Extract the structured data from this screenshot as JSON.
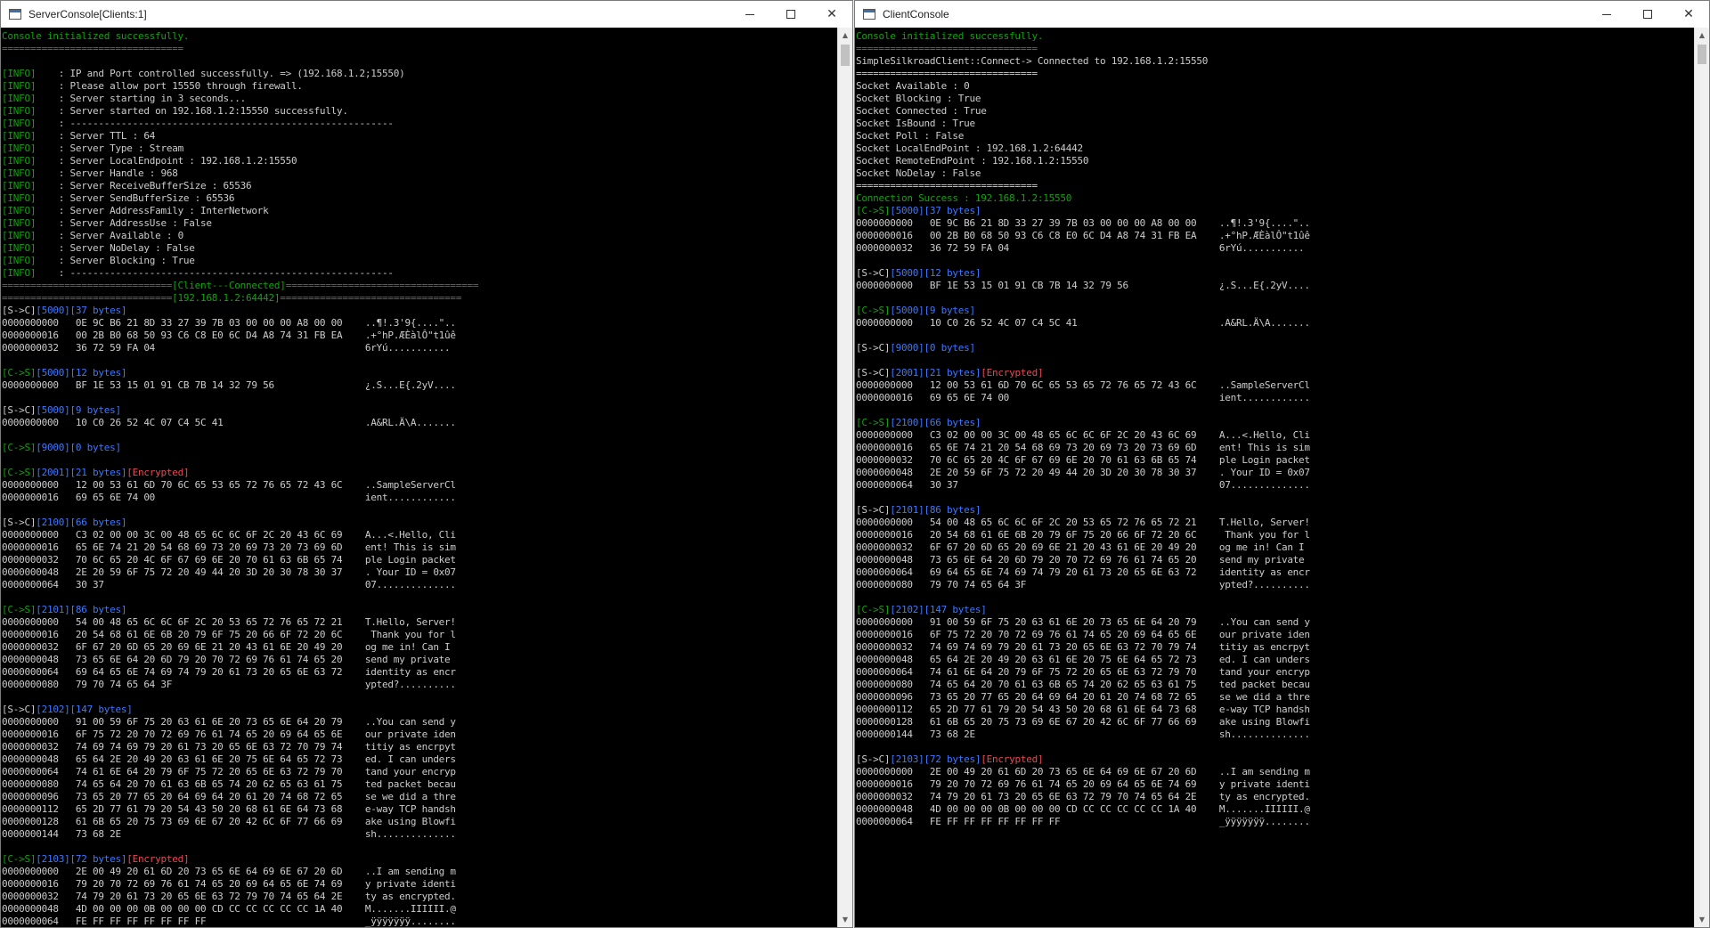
{
  "server": {
    "title": "ServerConsole[Clients:1]",
    "lines": [
      [
        [
          "g",
          "Console initialized successfully."
        ]
      ],
      [
        [
          "g",
          "================================"
        ]
      ],
      [],
      [
        [
          "g",
          "[INFO]"
        ],
        [
          "w",
          "    : IP and Port controlled successfully. => (192.168.1.2;15550)"
        ]
      ],
      [
        [
          "g",
          "[INFO]"
        ],
        [
          "w",
          "    : Please allow port 15550 through firewall."
        ]
      ],
      [
        [
          "g",
          "[INFO]"
        ],
        [
          "w",
          "    : Server starting in 3 seconds..."
        ]
      ],
      [
        [
          "g",
          "[INFO]"
        ],
        [
          "w",
          "    : Server started on 192.168.1.2:15550 successfully."
        ]
      ],
      [
        [
          "g",
          "[INFO]"
        ],
        [
          "w",
          "    : ---------------------------------------------------------"
        ]
      ],
      [
        [
          "g",
          "[INFO]"
        ],
        [
          "w",
          "    : Server TTL : 64"
        ]
      ],
      [
        [
          "g",
          "[INFO]"
        ],
        [
          "w",
          "    : Server Type : Stream"
        ]
      ],
      [
        [
          "g",
          "[INFO]"
        ],
        [
          "w",
          "    : Server LocalEndpoint : 192.168.1.2:15550"
        ]
      ],
      [
        [
          "g",
          "[INFO]"
        ],
        [
          "w",
          "    : Server Handle : 968"
        ]
      ],
      [
        [
          "g",
          "[INFO]"
        ],
        [
          "w",
          "    : Server ReceiveBufferSize : 65536"
        ]
      ],
      [
        [
          "g",
          "[INFO]"
        ],
        [
          "w",
          "    : Server SendBufferSize : 65536"
        ]
      ],
      [
        [
          "g",
          "[INFO]"
        ],
        [
          "w",
          "    : Server AddressFamily : InterNetwork"
        ]
      ],
      [
        [
          "g",
          "[INFO]"
        ],
        [
          "w",
          "    : Server AddressUse : False"
        ]
      ],
      [
        [
          "g",
          "[INFO]"
        ],
        [
          "w",
          "    : Server Available : 0"
        ]
      ],
      [
        [
          "g",
          "[INFO]"
        ],
        [
          "w",
          "    : Server NoDelay : False"
        ]
      ],
      [
        [
          "g",
          "[INFO]"
        ],
        [
          "w",
          "    : Server Blocking : True"
        ]
      ],
      [
        [
          "g",
          "[INFO]"
        ],
        [
          "w",
          "    : ---------------------------------------------------------"
        ]
      ],
      [
        [
          "g",
          "==============================[Client---Connected]=================================="
        ]
      ],
      [
        [
          "g",
          "==============================[192.168.1.2:64442]================================"
        ]
      ],
      [
        [
          "w",
          "[S->C]"
        ],
        [
          "b",
          "[5000][37 bytes]"
        ]
      ],
      [
        [
          "w",
          "0000000000   0E 9C B6 21 8D 33 27 39 7B 03 00 00 00 A8 00 00    ..¶!.3'9{....\"..  "
        ]
      ],
      [
        [
          "w",
          "0000000016   00 2B B0 68 50 93 C6 C8 E0 6C D4 A8 74 31 FB EA    .+°hP.ÆÈàlÔ\"t1ûê"
        ]
      ],
      [
        [
          "w",
          "0000000032   36 72 59 FA 04                                     6rYú..........."
        ]
      ],
      [],
      [
        [
          "g",
          "[C->S]"
        ],
        [
          "b",
          "[5000][12 bytes]"
        ]
      ],
      [
        [
          "w",
          "0000000000   BF 1E 53 15 01 91 CB 7B 14 32 79 56                ¿.S...E{.2yV...."
        ]
      ],
      [],
      [
        [
          "w",
          "[S->C]"
        ],
        [
          "b",
          "[5000][9 bytes]"
        ]
      ],
      [
        [
          "w",
          "0000000000   10 C0 26 52 4C 07 C4 5C 41                         .A&RL.Ä\\A......."
        ]
      ],
      [],
      [
        [
          "g",
          "[C->S]"
        ],
        [
          "b",
          "[9000][0 bytes]"
        ]
      ],
      [],
      [
        [
          "g",
          "[C->S]"
        ],
        [
          "b",
          "[2001][21 bytes]"
        ],
        [
          "r",
          "[Encrypted]"
        ]
      ],
      [
        [
          "w",
          "0000000000   12 00 53 61 6D 70 6C 65 53 65 72 76 65 72 43 6C    ..SampleServerCl"
        ]
      ],
      [
        [
          "w",
          "0000000016   69 65 6E 74 00                                     ient............"
        ]
      ],
      [],
      [
        [
          "w",
          "[S->C]"
        ],
        [
          "b",
          "[2100][66 bytes]"
        ]
      ],
      [
        [
          "w",
          "0000000000   C3 02 00 00 3C 00 48 65 6C 6C 6F 2C 20 43 6C 69    A...<.Hello, Cli"
        ]
      ],
      [
        [
          "w",
          "0000000016   65 6E 74 21 20 54 68 69 73 20 69 73 20 73 69 6D    ent! This is sim"
        ]
      ],
      [
        [
          "w",
          "0000000032   70 6C 65 20 4C 6F 67 69 6E 20 70 61 63 6B 65 74    ple Login packet"
        ]
      ],
      [
        [
          "w",
          "0000000048   2E 20 59 6F 75 72 20 49 44 20 3D 20 30 78 30 37    . Your ID = 0x07"
        ]
      ],
      [
        [
          "w",
          "0000000064   30 37                                              07.............."
        ]
      ],
      [],
      [
        [
          "g",
          "[C->S]"
        ],
        [
          "b",
          "[2101][86 bytes]"
        ]
      ],
      [
        [
          "w",
          "0000000000   54 00 48 65 6C 6C 6F 2C 20 53 65 72 76 65 72 21    T.Hello, Server!"
        ]
      ],
      [
        [
          "w",
          "0000000016   20 54 68 61 6E 6B 20 79 6F 75 20 66 6F 72 20 6C     Thank you for l"
        ]
      ],
      [
        [
          "w",
          "0000000032   6F 67 20 6D 65 20 69 6E 21 20 43 61 6E 20 49 20    og me in! Can I "
        ]
      ],
      [
        [
          "w",
          "0000000048   73 65 6E 64 20 6D 79 20 70 72 69 76 61 74 65 20    send my private "
        ]
      ],
      [
        [
          "w",
          "0000000064   69 64 65 6E 74 69 74 79 20 61 73 20 65 6E 63 72    identity as encr"
        ]
      ],
      [
        [
          "w",
          "0000000080   79 70 74 65 64 3F                                  ypted?.........."
        ]
      ],
      [],
      [
        [
          "w",
          "[S->C]"
        ],
        [
          "b",
          "[2102][147 bytes]"
        ]
      ],
      [
        [
          "w",
          "0000000000   91 00 59 6F 75 20 63 61 6E 20 73 65 6E 64 20 79    ..You can send y"
        ]
      ],
      [
        [
          "w",
          "0000000016   6F 75 72 20 70 72 69 76 61 74 65 20 69 64 65 6E    our private iden"
        ]
      ],
      [
        [
          "w",
          "0000000032   74 69 74 69 79 20 61 73 20 65 6E 63 72 70 79 74    titiy as encrpyt"
        ]
      ],
      [
        [
          "w",
          "0000000048   65 64 2E 20 49 20 63 61 6E 20 75 6E 64 65 72 73    ed. I can unders"
        ]
      ],
      [
        [
          "w",
          "0000000064   74 61 6E 64 20 79 6F 75 72 20 65 6E 63 72 79 70    tand your encryp"
        ]
      ],
      [
        [
          "w",
          "0000000080   74 65 64 20 70 61 63 6B 65 74 20 62 65 63 61 75    ted packet becau"
        ]
      ],
      [
        [
          "w",
          "0000000096   73 65 20 77 65 20 64 69 64 20 61 20 74 68 72 65    se we did a thre"
        ]
      ],
      [
        [
          "w",
          "0000000112   65 2D 77 61 79 20 54 43 50 20 68 61 6E 64 73 68    e-way TCP handsh"
        ]
      ],
      [
        [
          "w",
          "0000000128   61 6B 65 20 75 73 69 6E 67 20 42 6C 6F 77 66 69    ake using Blowfi"
        ]
      ],
      [
        [
          "w",
          "0000000144   73 68 2E                                           sh.............."
        ]
      ],
      [],
      [
        [
          "g",
          "[C->S]"
        ],
        [
          "b",
          "[2103][72 bytes]"
        ],
        [
          "r",
          "[Encrypted]"
        ]
      ],
      [
        [
          "w",
          "0000000000   2E 00 49 20 61 6D 20 73 65 6E 64 69 6E 67 20 6D    ..I am sending m"
        ]
      ],
      [
        [
          "w",
          "0000000016   79 20 70 72 69 76 61 74 65 20 69 64 65 6E 74 69    y private identi"
        ]
      ],
      [
        [
          "w",
          "0000000032   74 79 20 61 73 20 65 6E 63 72 79 70 74 65 64 2E    ty as encrypted."
        ]
      ],
      [
        [
          "w",
          "0000000048   4D 00 00 00 0B 00 00 00 CD CC CC CC CC CC 1A 40    M.......IIIIII.@"
        ]
      ],
      [
        [
          "w",
          "0000000064   FE FF FF FF FF FF FF FF                            _ÿÿÿÿÿÿÿ........"
        ]
      ]
    ]
  },
  "client": {
    "title": "ClientConsole",
    "lines": [
      [
        [
          "g",
          "Console initialized successfully."
        ]
      ],
      [
        [
          "g",
          "================================"
        ]
      ],
      [
        [
          "w",
          "SimpleSilkroadClient::Connect-> Connected to 192.168.1.2:15550"
        ]
      ],
      [
        [
          "w",
          "================================"
        ]
      ],
      [
        [
          "w",
          "Socket Available : 0"
        ]
      ],
      [
        [
          "w",
          "Socket Blocking : True"
        ]
      ],
      [
        [
          "w",
          "Socket Connected : True"
        ]
      ],
      [
        [
          "w",
          "Socket IsBound : True"
        ]
      ],
      [
        [
          "w",
          "Socket Poll : False"
        ]
      ],
      [
        [
          "w",
          "Socket LocalEndPoint : 192.168.1.2:64442"
        ]
      ],
      [
        [
          "w",
          "Socket RemoteEndPoint : 192.168.1.2:15550"
        ]
      ],
      [
        [
          "w",
          "Socket NoDelay : False"
        ]
      ],
      [
        [
          "w",
          "================================"
        ]
      ],
      [
        [
          "g",
          "Connection Success : 192.168.1.2:15550"
        ]
      ],
      [
        [
          "g",
          "[C->S]"
        ],
        [
          "b",
          "[5000][37 bytes]"
        ]
      ],
      [
        [
          "w",
          "0000000000   0E 9C B6 21 8D 33 27 39 7B 03 00 00 00 A8 00 00    ..¶!.3'9{....\".."
        ]
      ],
      [
        [
          "w",
          "0000000016   00 2B B0 68 50 93 C6 C8 E0 6C D4 A8 74 31 FB EA    .+°hP.ÆÈàlÔ\"t1ûê"
        ]
      ],
      [
        [
          "w",
          "0000000032   36 72 59 FA 04                                     6rYú..........."
        ]
      ],
      [],
      [
        [
          "w",
          "[S->C]"
        ],
        [
          "b",
          "[5000][12 bytes]"
        ]
      ],
      [
        [
          "w",
          "0000000000   BF 1E 53 15 01 91 CB 7B 14 32 79 56                ¿.S...E{.2yV...."
        ]
      ],
      [],
      [
        [
          "g",
          "[C->S]"
        ],
        [
          "b",
          "[5000][9 bytes]"
        ]
      ],
      [
        [
          "w",
          "0000000000   10 C0 26 52 4C 07 C4 5C 41                         .A&RL.Ä\\A......."
        ]
      ],
      [],
      [
        [
          "w",
          "[S->C]"
        ],
        [
          "b",
          "[9000][0 bytes]"
        ]
      ],
      [],
      [
        [
          "w",
          "[S->C]"
        ],
        [
          "b",
          "[2001][21 bytes]"
        ],
        [
          "r",
          "[Encrypted]"
        ]
      ],
      [
        [
          "w",
          "0000000000   12 00 53 61 6D 70 6C 65 53 65 72 76 65 72 43 6C    ..SampleServerCl"
        ]
      ],
      [
        [
          "w",
          "0000000016   69 65 6E 74 00                                     ient............"
        ]
      ],
      [],
      [
        [
          "g",
          "[C->S]"
        ],
        [
          "b",
          "[2100][66 bytes]"
        ]
      ],
      [
        [
          "w",
          "0000000000   C3 02 00 00 3C 00 48 65 6C 6C 6F 2C 20 43 6C 69    A...<.Hello, Cli"
        ]
      ],
      [
        [
          "w",
          "0000000016   65 6E 74 21 20 54 68 69 73 20 69 73 20 73 69 6D    ent! This is sim"
        ]
      ],
      [
        [
          "w",
          "0000000032   70 6C 65 20 4C 6F 67 69 6E 20 70 61 63 6B 65 74    ple Login packet"
        ]
      ],
      [
        [
          "w",
          "0000000048   2E 20 59 6F 75 72 20 49 44 20 3D 20 30 78 30 37    . Your ID = 0x07"
        ]
      ],
      [
        [
          "w",
          "0000000064   30 37                                              07.............."
        ]
      ],
      [],
      [
        [
          "w",
          "[S->C]"
        ],
        [
          "b",
          "[2101][86 bytes]"
        ]
      ],
      [
        [
          "w",
          "0000000000   54 00 48 65 6C 6C 6F 2C 20 53 65 72 76 65 72 21    T.Hello, Server!"
        ]
      ],
      [
        [
          "w",
          "0000000016   20 54 68 61 6E 6B 20 79 6F 75 20 66 6F 72 20 6C     Thank you for l"
        ]
      ],
      [
        [
          "w",
          "0000000032   6F 67 20 6D 65 20 69 6E 21 20 43 61 6E 20 49 20    og me in! Can I "
        ]
      ],
      [
        [
          "w",
          "0000000048   73 65 6E 64 20 6D 79 20 70 72 69 76 61 74 65 20    send my private "
        ]
      ],
      [
        [
          "w",
          "0000000064   69 64 65 6E 74 69 74 79 20 61 73 20 65 6E 63 72    identity as encr"
        ]
      ],
      [
        [
          "w",
          "0000000080   79 70 74 65 64 3F                                  ypted?.........."
        ]
      ],
      [],
      [
        [
          "g",
          "[C->S]"
        ],
        [
          "b",
          "[2102][147 bytes]"
        ]
      ],
      [
        [
          "w",
          "0000000000   91 00 59 6F 75 20 63 61 6E 20 73 65 6E 64 20 79    ..You can send y"
        ]
      ],
      [
        [
          "w",
          "0000000016   6F 75 72 20 70 72 69 76 61 74 65 20 69 64 65 6E    our private iden"
        ]
      ],
      [
        [
          "w",
          "0000000032   74 69 74 69 79 20 61 73 20 65 6E 63 72 70 79 74    titiy as encrpyt"
        ]
      ],
      [
        [
          "w",
          "0000000048   65 64 2E 20 49 20 63 61 6E 20 75 6E 64 65 72 73    ed. I can unders"
        ]
      ],
      [
        [
          "w",
          "0000000064   74 61 6E 64 20 79 6F 75 72 20 65 6E 63 72 79 70    tand your encryp"
        ]
      ],
      [
        [
          "w",
          "0000000080   74 65 64 20 70 61 63 6B 65 74 20 62 65 63 61 75    ted packet becau"
        ]
      ],
      [
        [
          "w",
          "0000000096   73 65 20 77 65 20 64 69 64 20 61 20 74 68 72 65    se we did a thre"
        ]
      ],
      [
        [
          "w",
          "0000000112   65 2D 77 61 79 20 54 43 50 20 68 61 6E 64 73 68    e-way TCP handsh"
        ]
      ],
      [
        [
          "w",
          "0000000128   61 6B 65 20 75 73 69 6E 67 20 42 6C 6F 77 66 69    ake using Blowfi"
        ]
      ],
      [
        [
          "w",
          "0000000144   73 68 2E                                           sh.............."
        ]
      ],
      [],
      [
        [
          "w",
          "[S->C]"
        ],
        [
          "b",
          "[2103][72 bytes]"
        ],
        [
          "r",
          "[Encrypted]"
        ]
      ],
      [
        [
          "w",
          "0000000000   2E 00 49 20 61 6D 20 73 65 6E 64 69 6E 67 20 6D    ..I am sending m"
        ]
      ],
      [
        [
          "w",
          "0000000016   79 20 70 72 69 76 61 74 65 20 69 64 65 6E 74 69    y private identi"
        ]
      ],
      [
        [
          "w",
          "0000000032   74 79 20 61 73 20 65 6E 63 72 79 70 74 65 64 2E    ty as encrypted."
        ]
      ],
      [
        [
          "w",
          "0000000048   4D 00 00 00 0B 00 00 00 CD CC CC CC CC CC 1A 40    M.......IIIIII.@"
        ]
      ],
      [
        [
          "w",
          "0000000064   FE FF FF FF FF FF FF FF                            _ÿÿÿÿÿÿÿ........"
        ]
      ]
    ]
  },
  "window_controls": {
    "minimize": "—",
    "maximize": "☐",
    "close": "✕"
  },
  "scrollbar": {
    "up": "▲",
    "down": "▼"
  },
  "colors": {
    "info_green": "#13a10e",
    "opcode_blue": "#3b78ff",
    "encrypted_red": "#e74856",
    "text": "#cccccc",
    "background": "#000000"
  }
}
